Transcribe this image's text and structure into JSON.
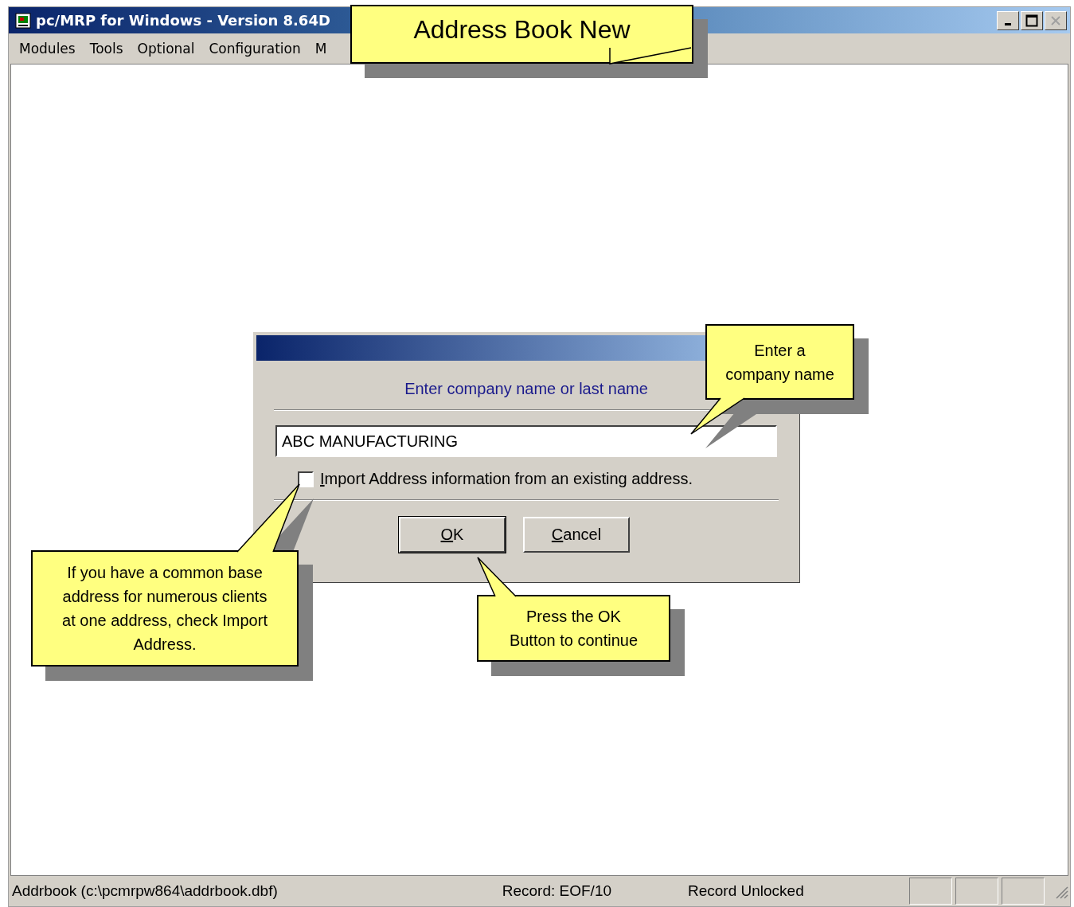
{
  "window": {
    "title": "pc/MRP for Windows - Version 8.64D"
  },
  "menu": [
    {
      "label": "Modules"
    },
    {
      "label": "Tools"
    },
    {
      "label": "Optional"
    },
    {
      "label": "Configuration"
    },
    {
      "label": "M"
    }
  ],
  "dialog": {
    "prompt": "Enter company name or last name",
    "field": {
      "value": "ABC MANUFACTURING"
    },
    "import_option": {
      "label": "Import Address information from an existing address.",
      "checked": false,
      "mnemonic_first": true
    },
    "buttons": [
      {
        "label": "OK",
        "mnemonic_first": true,
        "kind": "default"
      },
      {
        "label": "Cancel",
        "mnemonic_first": true,
        "kind": "normal"
      }
    ]
  },
  "callouts": [
    {
      "lines": [
        "Address Book New"
      ],
      "kind": "title"
    },
    {
      "lines": [
        "Enter a",
        "company name"
      ],
      "kind": "field"
    },
    {
      "lines": [
        "If you have a common base",
        "address for numerous clients",
        "at one address, check Import",
        "Address."
      ],
      "kind": "checkbox"
    },
    {
      "lines": [
        "Press the OK",
        "Button to continue"
      ],
      "kind": "button"
    }
  ],
  "status_bar": {
    "file": "Addrbook (c:\\pcmrpw864\\addrbook.dbf)",
    "record": "Record: EOF/10",
    "lock": "Record Unlocked"
  }
}
